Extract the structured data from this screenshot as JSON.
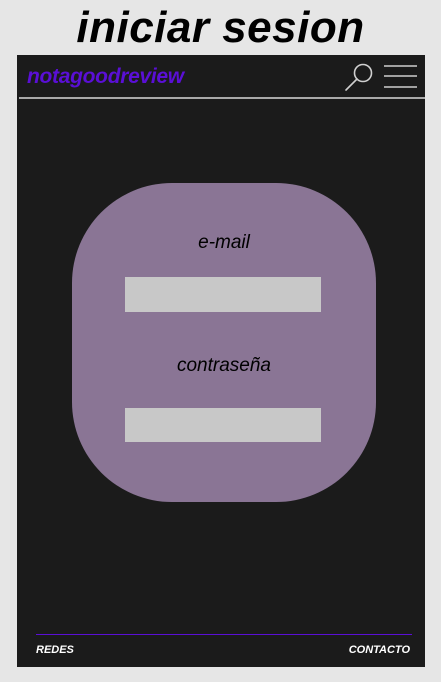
{
  "page": {
    "heading": "iniciar sesion"
  },
  "header": {
    "brand": "notagoodreview",
    "icons": {
      "search": "search-icon",
      "menu": "hamburger-menu-icon"
    }
  },
  "login_form": {
    "email_label": "e-mail",
    "email_value": "",
    "email_placeholder": "",
    "password_label": "contraseña",
    "password_value": "",
    "password_placeholder": ""
  },
  "footer": {
    "left_link": "REDES",
    "right_link": "CONTACTO"
  },
  "colors": {
    "page_background": "#e6e6e6",
    "screen_background": "#1b1b1b",
    "brand": "#5a0fd6",
    "card": "#8a7595",
    "input": "#c8c8c8",
    "divider": "#a9a9a9",
    "footer_divider": "#5a0fd6",
    "footer_text": "#ffffff"
  }
}
